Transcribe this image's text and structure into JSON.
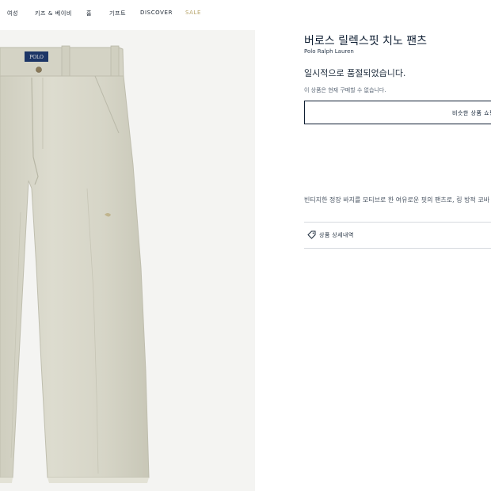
{
  "nav": {
    "items": [
      {
        "label": "여성",
        "accent": false
      },
      {
        "label": "키즈 & 베이비",
        "accent": false
      },
      {
        "label": "홈",
        "accent": false
      },
      {
        "label": "기프트",
        "accent": false
      },
      {
        "label": "DISCOVER",
        "accent": false
      },
      {
        "label": "SALE",
        "accent": true
      }
    ],
    "accent_color": "#b8a56c"
  },
  "product": {
    "title": "버로스 릴렉스핏 치노 팬츠",
    "brand": "Polo Ralph Lauren",
    "status": "일시적으로 품절되었습니다.",
    "unavailable_note": "이 상품은 현재 구매할 수 없습니다.",
    "similar_button": "비슷한 상품 쇼핑",
    "description": "빈티지한 정장 바지를 모티브로 한 여유로운 핏의 팬츠로, 링 방적 코바",
    "details_label": "상품 상세내역",
    "image_label": "POLO"
  },
  "colors": {
    "navy": "#041e3a",
    "pants": "#d9d8cb"
  }
}
